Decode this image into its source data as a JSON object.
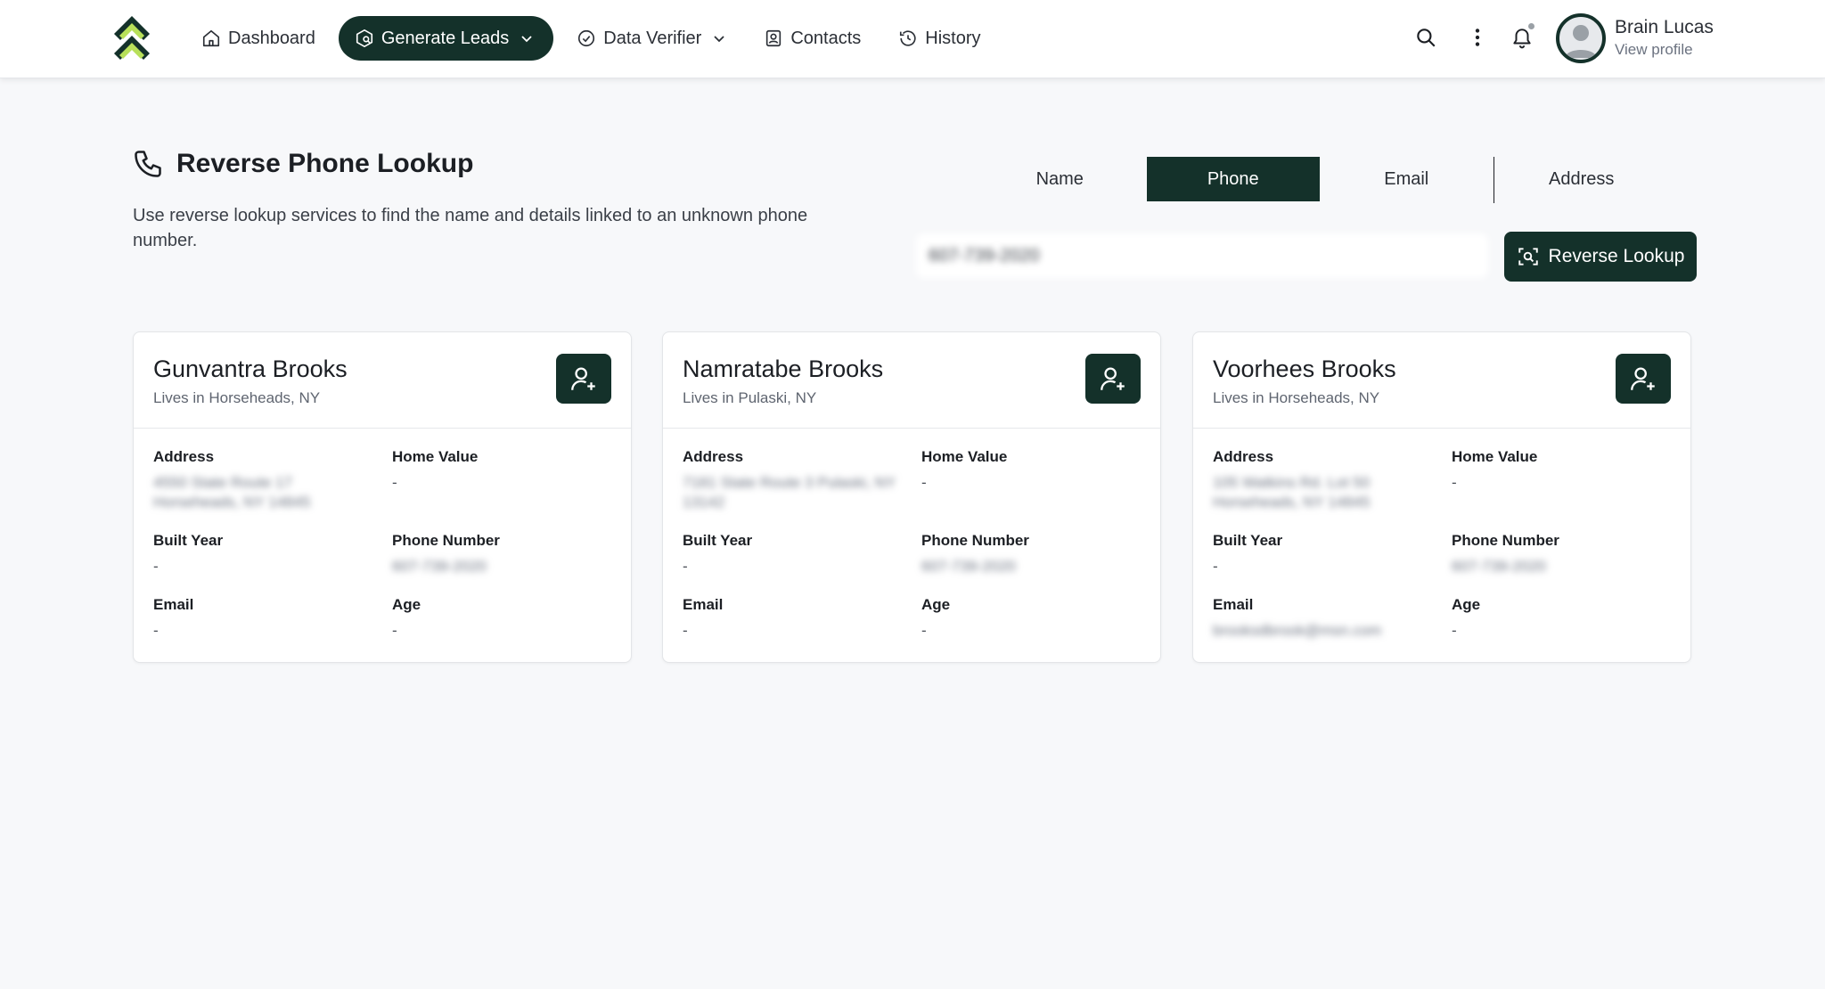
{
  "header": {
    "nav": [
      {
        "label": "Dashboard",
        "icon": "home-icon"
      },
      {
        "label": "Generate Leads",
        "icon": "leads-icon",
        "active": true,
        "dropdown": true
      },
      {
        "label": "Data Verifier",
        "icon": "check-circle-icon",
        "dropdown": true
      },
      {
        "label": "Contacts",
        "icon": "contacts-icon"
      },
      {
        "label": "History",
        "icon": "history-icon"
      }
    ],
    "user": {
      "name": "Brain Lucas",
      "link": "View profile"
    }
  },
  "lookup": {
    "title": "Reverse Phone Lookup",
    "description": "Use reverse lookup services to find the name and details linked to an unknown phone number.",
    "tabs": [
      "Name",
      "Phone",
      "Email",
      "Address"
    ],
    "active_tab": "Phone",
    "input_value": "607-739-2020",
    "button_label": "Reverse Lookup"
  },
  "labels": {
    "address": "Address",
    "home_value": "Home Value",
    "built_year": "Built Year",
    "phone_number": "Phone Number",
    "email": "Email",
    "age": "Age"
  },
  "cards": [
    {
      "name": "Gunvantra Brooks",
      "location": "Lives in Horseheads, NY",
      "address": "4550 State Route 17 Horseheads, NY 14845",
      "home_value": "-",
      "built_year": "-",
      "phone": "607-739-2020",
      "email": "-",
      "age": "-"
    },
    {
      "name": "Namratabe Brooks",
      "location": "Lives in Pulaski, NY",
      "address": "7181 State Route 3 Pulaski, NY 13142",
      "home_value": "-",
      "built_year": "-",
      "phone": "607-739-2020",
      "email": "-",
      "age": "-"
    },
    {
      "name": "Voorhees Brooks",
      "location": "Lives in Horseheads, NY",
      "address": "105 Watkins Rd. Lot 50 Horseheads, NY 14845",
      "home_value": "-",
      "built_year": "-",
      "phone": "607-739-2020",
      "email": "brooksdbrook@msn.com",
      "age": "-"
    }
  ]
}
